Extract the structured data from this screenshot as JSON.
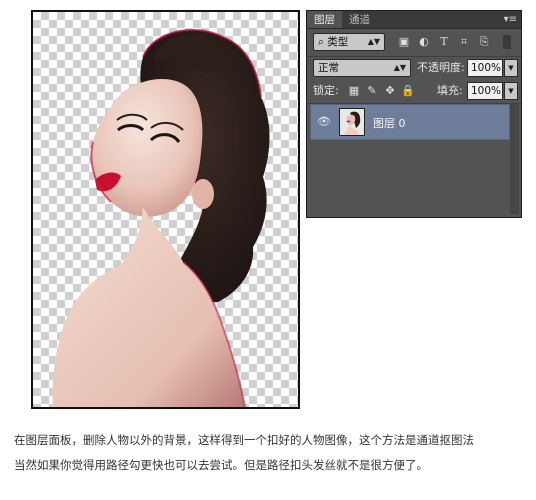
{
  "panel": {
    "tabs": [
      {
        "label": "图层",
        "active": true
      },
      {
        "label": "通道",
        "active": false
      }
    ],
    "menu_icon": "panel-menu-icon",
    "filter": {
      "label": "类型",
      "icon": "search-icon"
    },
    "filter_icons": [
      "image-filter-icon",
      "adjustment-filter-icon",
      "text-filter-icon",
      "shape-filter-icon",
      "smart-object-filter-icon",
      "filter-toggle-icon"
    ],
    "blend_mode": "正常",
    "opacity_label": "不透明度:",
    "opacity_value": "100%",
    "lock_label": "锁定:",
    "lock_icons": [
      "lock-pixels-icon",
      "lock-image-icon",
      "lock-position-icon",
      "lock-all-icon"
    ],
    "fill_label": "填充:",
    "fill_value": "100%",
    "layers": [
      {
        "name": "图层 0",
        "visible": true,
        "selected": true
      }
    ]
  },
  "caption": {
    "line1": "在图层面板，删除人物以外的背景，这样得到一个扣好的人物图像，这个方法是通道抠图法",
    "line2": "当然如果你觉得用路径勾更快也可以去尝试。但是路径扣头发丝就不是很方便了。"
  }
}
